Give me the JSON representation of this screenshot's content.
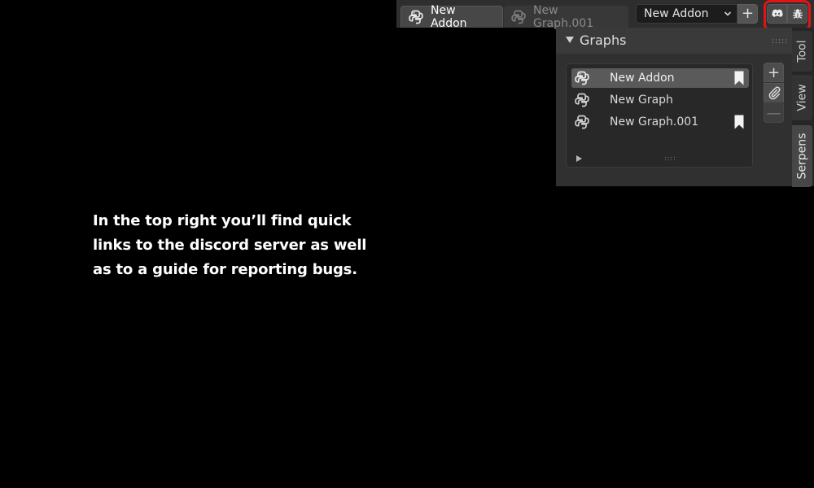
{
  "header": {
    "tabs": [
      {
        "label": "New Addon",
        "icon": "python-icon",
        "active": true
      },
      {
        "label": "New Graph.001",
        "icon": "python-icon",
        "active": false
      }
    ],
    "addon_select": {
      "value": "New Addon",
      "icon": "chevron-down-icon"
    },
    "add_icon": "+",
    "quick_links": [
      {
        "name": "discord",
        "icon": "discord-icon"
      },
      {
        "name": "bug-report",
        "icon": "bug-icon"
      }
    ],
    "highlight_color": "#e01515"
  },
  "panel": {
    "title": "Graphs",
    "graphs": [
      {
        "label": "New Addon",
        "selected": true,
        "bookmarked": true
      },
      {
        "label": "New Graph",
        "selected": false,
        "bookmarked": false
      },
      {
        "label": "New Graph.001",
        "selected": false,
        "bookmarked": true
      }
    ],
    "side_buttons": {
      "add": "+",
      "remove": "—"
    }
  },
  "vertical_tabs": [
    {
      "label": "Tool"
    },
    {
      "label": "View"
    },
    {
      "label": "Serpens",
      "active": true
    }
  ],
  "caption": {
    "line1": "In the top right you’ll find quick",
    "line2": "links to the discord server as well",
    "line3": "as to a guide for reporting bugs."
  }
}
